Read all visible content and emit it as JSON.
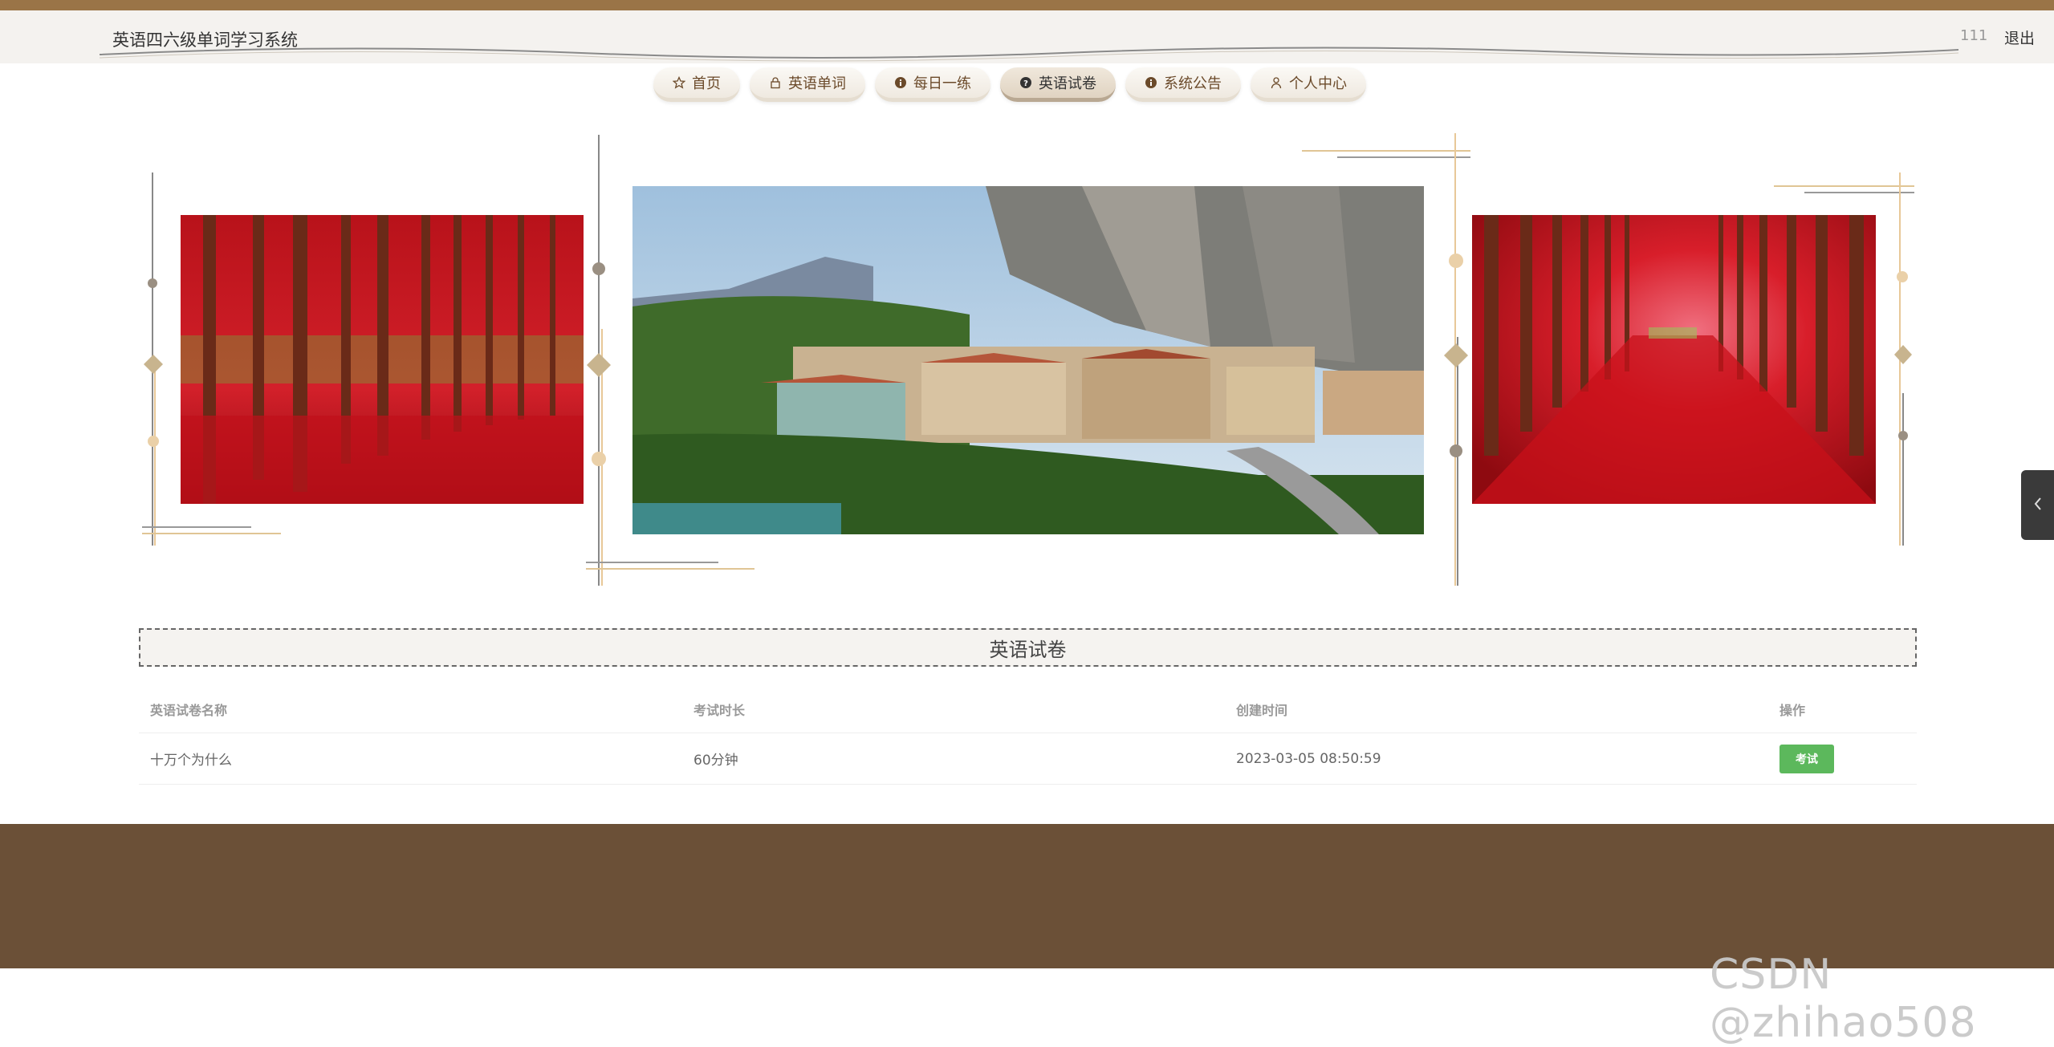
{
  "header": {
    "site_title": "英语四六级单词学习系统",
    "username": "111",
    "logout_label": "退出"
  },
  "nav": {
    "items": [
      {
        "label": "首页",
        "icon": "star-icon"
      },
      {
        "label": "英语单词",
        "icon": "lock-icon"
      },
      {
        "label": "每日一练",
        "icon": "info-circle-icon"
      },
      {
        "label": "英语试卷",
        "icon": "question-circle-icon",
        "active": true
      },
      {
        "label": "系统公告",
        "icon": "info-circle-icon"
      },
      {
        "label": "个人中心",
        "icon": "user-icon"
      }
    ]
  },
  "carousel": {
    "slides": [
      "red-tree-forest",
      "mountain-village",
      "red-tree-avenue"
    ],
    "active_index": 1,
    "dot_count": 2
  },
  "section": {
    "title": "英语试卷"
  },
  "exam_table": {
    "headers": [
      "英语试卷名称",
      "考试时长",
      "创建时间",
      "操作"
    ],
    "rows": [
      {
        "name": "十万个为什么",
        "duration": "60分钟",
        "created": "2023-03-05 08:50:59",
        "action": "考试"
      }
    ]
  },
  "watermark": "CSDN @zhihao508",
  "colors": {
    "brand_brown": "#9a7447",
    "footer": "#6b5037",
    "button_green": "#5cb85c"
  }
}
